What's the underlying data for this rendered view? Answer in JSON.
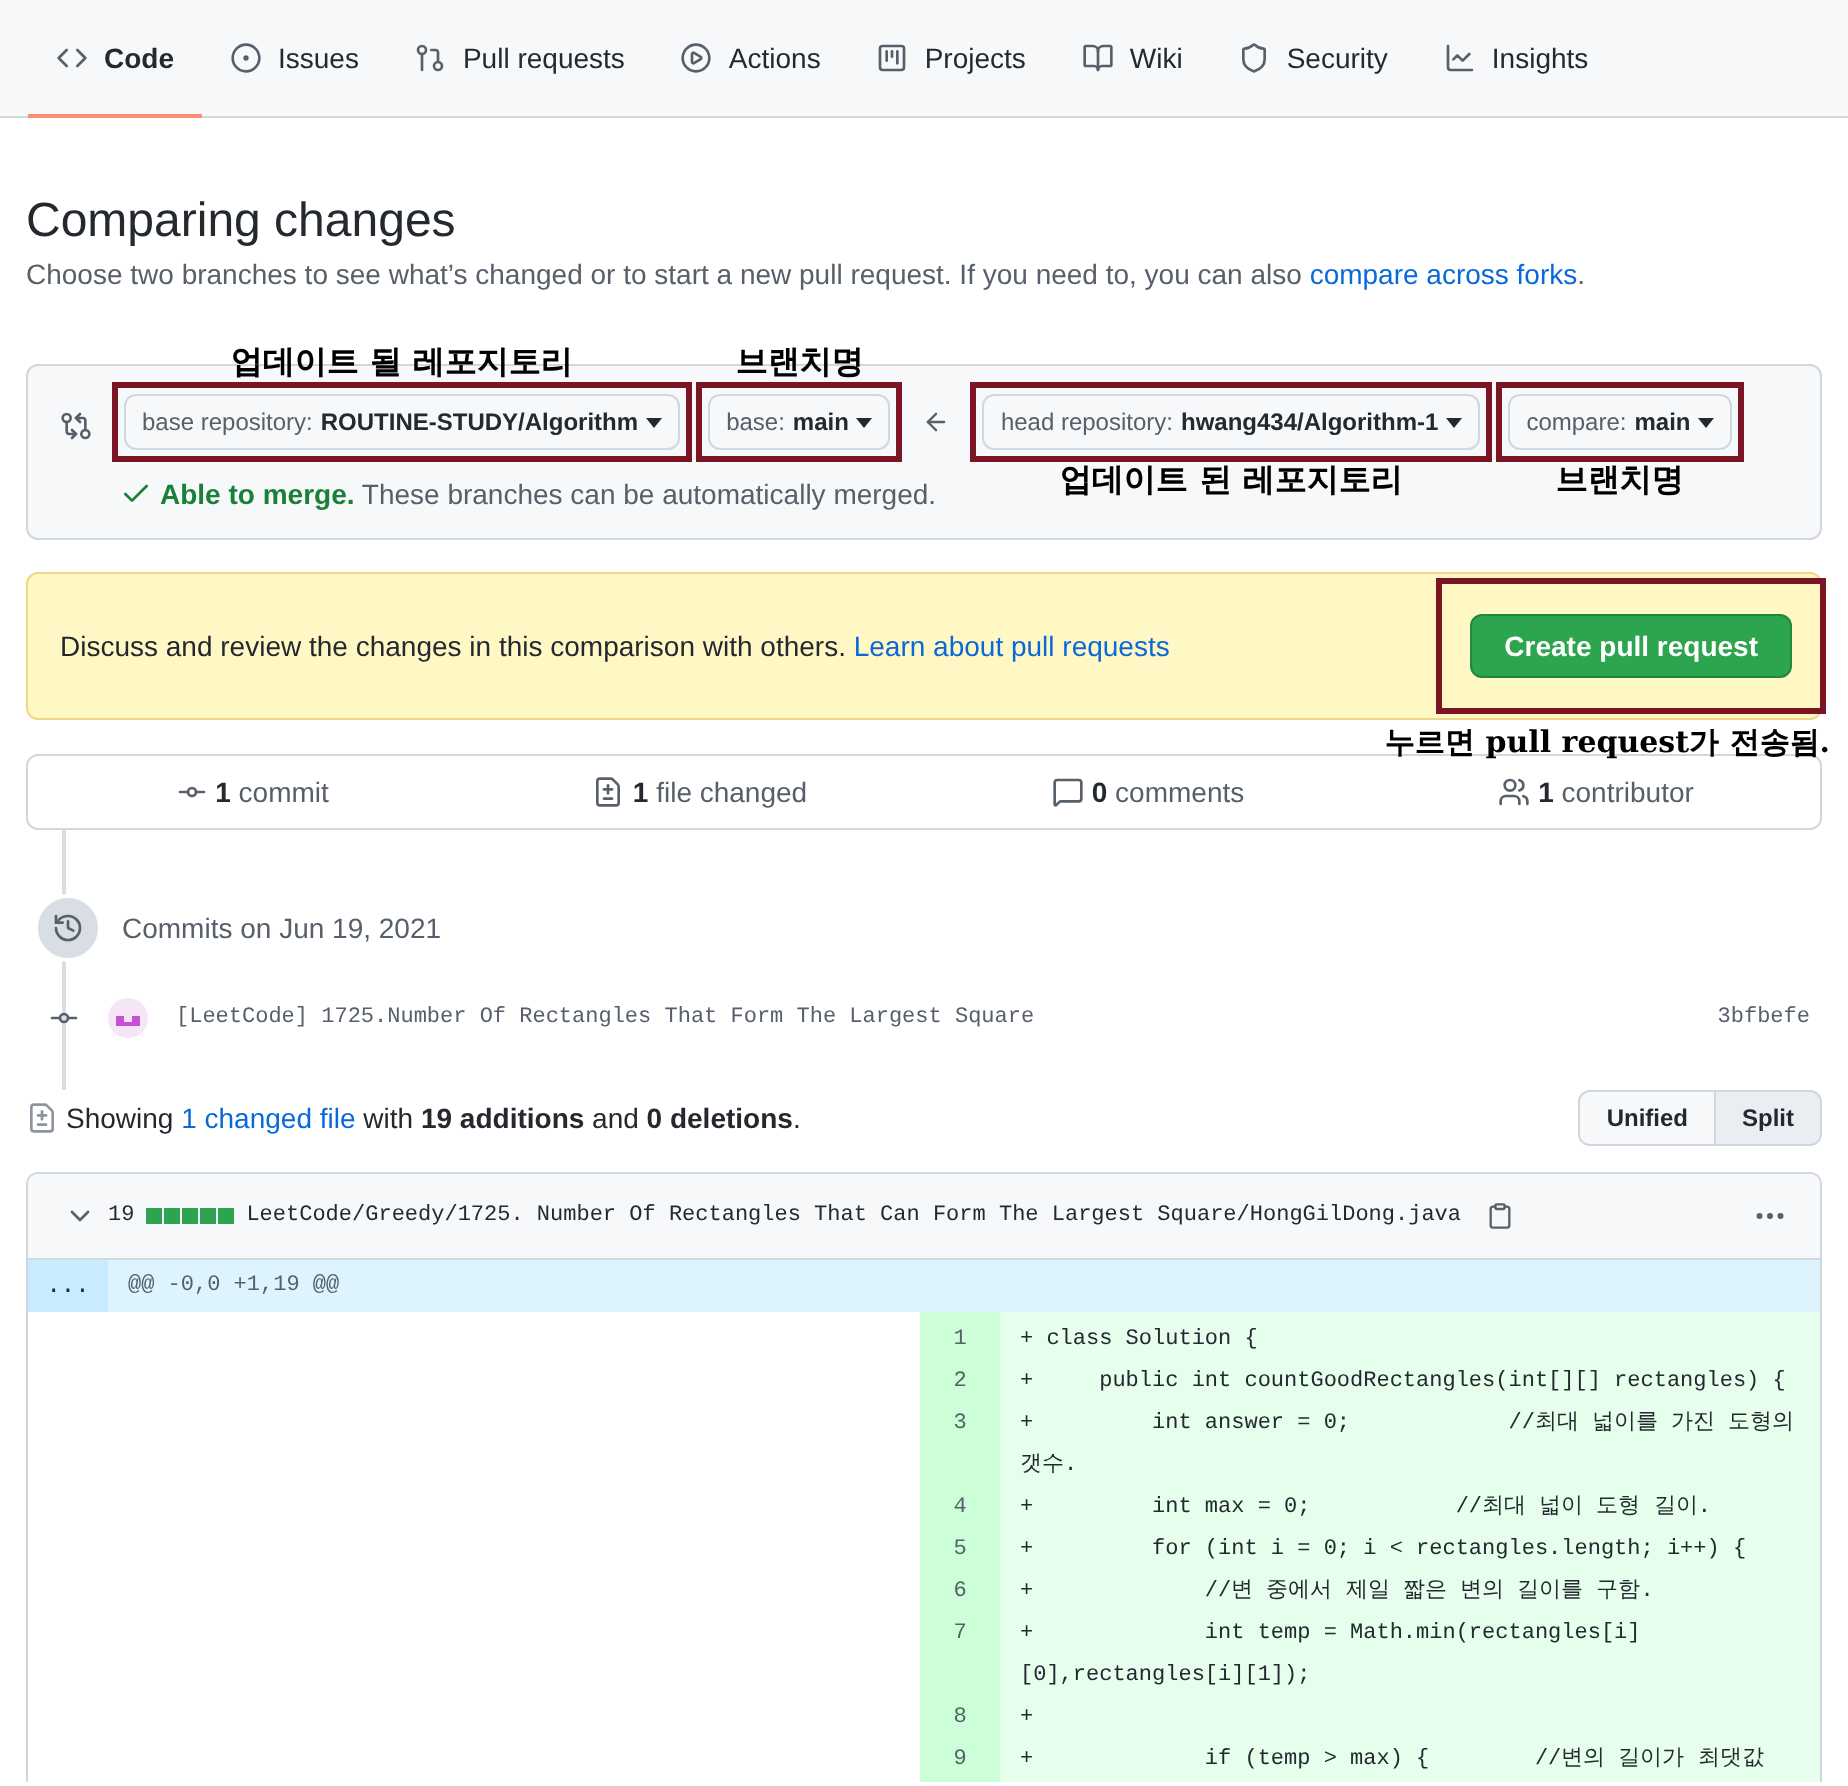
{
  "nav_tabs": [
    {
      "label": "Code",
      "selected": true
    },
    {
      "label": "Issues",
      "selected": false
    },
    {
      "label": "Pull requests",
      "selected": false
    },
    {
      "label": "Actions",
      "selected": false
    },
    {
      "label": "Projects",
      "selected": false
    },
    {
      "label": "Wiki",
      "selected": false
    },
    {
      "label": "Security",
      "selected": false
    },
    {
      "label": "Insights",
      "selected": false
    }
  ],
  "heading": "Comparing changes",
  "subtitle": {
    "text": "Choose two branches to see what’s changed or to start a new pull request. If you need to, you can also ",
    "link": "compare across forks",
    "end": "."
  },
  "compare": {
    "selectors": [
      {
        "prefix": "base repository:",
        "value": "ROUTINE-STUDY/Algorithm",
        "annotation": "업데이트 될 레포지토리"
      },
      {
        "prefix": "base:",
        "value": "main",
        "annotation": "브랜치명"
      },
      {
        "prefix": "head repository:",
        "value": "hwang434/Algorithm-1",
        "annotation": "업데이트 된 레포지토리"
      },
      {
        "prefix": "compare:",
        "value": "main",
        "annotation": "브랜치명"
      }
    ],
    "merge": {
      "status": "Able to merge.",
      "message": "These branches can be automatically merged."
    }
  },
  "pull_request_box": {
    "text": "Discuss and review the changes in this comparison with others.",
    "link": "Learn about pull requests",
    "button": "Create pull request",
    "annotation": "누르면 pull request가 전송됨."
  },
  "stats": [
    {
      "count": "1",
      "label": "commit"
    },
    {
      "count": "1",
      "label": "file changed"
    },
    {
      "count": "0",
      "label": "comments"
    },
    {
      "count": "1",
      "label": "contributor"
    }
  ],
  "commits_heading": "Commits on Jun 19, 2021",
  "commits": [
    {
      "message": "[LeetCode] 1725.Number Of Rectangles That Form The Largest Square",
      "sha": "3bfbefe"
    }
  ],
  "summary": {
    "prefix": "Showing ",
    "link": "1 changed file",
    "rest": " with **19 additions** and **0 deletions**."
  },
  "view_toggle": [
    {
      "label": "Unified",
      "selected": false
    },
    {
      "label": "Split",
      "selected": true
    }
  ],
  "file": {
    "expanded": true,
    "additions": "19",
    "path": "LeetCode/Greedy/1725. Number Of Rectangles That Can Form The Largest Square/HongGilDong.java",
    "hunk_expander": "...",
    "hunk_header": "@@ -0,0 +1,19 @@",
    "lines": [
      {
        "number": "1",
        "code": "+ class Solution {"
      },
      {
        "number": "2",
        "code": "+     public int countGoodRectangles(int[][] rectangles) {"
      },
      {
        "number": "3",
        "code": "+         int answer = 0;            //최대 넓이를 가진 도형의 갯수."
      },
      {
        "number": "4",
        "code": "+         int max = 0;           //최대 넓이 도형 길이."
      },
      {
        "number": "5",
        "code": "+         for (int i = 0; i < rectangles.length; i++) {"
      },
      {
        "number": "6",
        "code": "+             //변 중에서 제일 짧은 변의 길이를 구함."
      },
      {
        "number": "7",
        "code": "+             int temp = Math.min(rectangles[i][0],rectangles[i][1]);"
      },
      {
        "number": "8",
        "code": "+"
      },
      {
        "number": "9",
        "code": "+             if (temp > max) {        //변의 길이가 최댓값"
      }
    ]
  }
}
